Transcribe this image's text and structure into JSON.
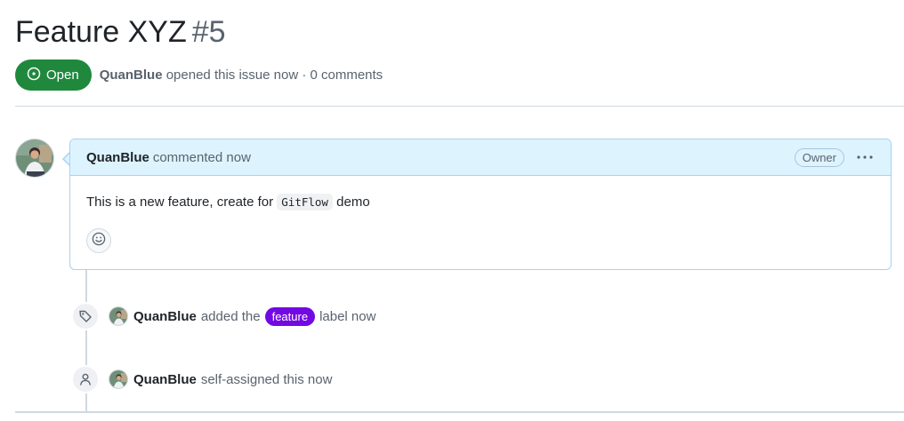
{
  "issue": {
    "title": "Feature XYZ",
    "number": "#5",
    "state_label": "Open",
    "author": "QuanBlue",
    "meta_text": "opened this issue now · 0 comments"
  },
  "comment": {
    "author": "QuanBlue",
    "action": "commented now",
    "role_badge": "Owner",
    "body_prefix": "This is a new feature, create for",
    "body_code": "GitFlow",
    "body_suffix": "demo"
  },
  "events": [
    {
      "icon": "tag-icon",
      "actor": "QuanBlue",
      "pre": "added the",
      "label_name": "feature",
      "post": "label now"
    },
    {
      "icon": "person-icon",
      "actor": "QuanBlue",
      "text": "self-assigned this now"
    }
  ],
  "colors": {
    "open_green": "#1f883d",
    "comment_header_bg": "#ddf4ff",
    "feature_label": "#7209e3"
  }
}
